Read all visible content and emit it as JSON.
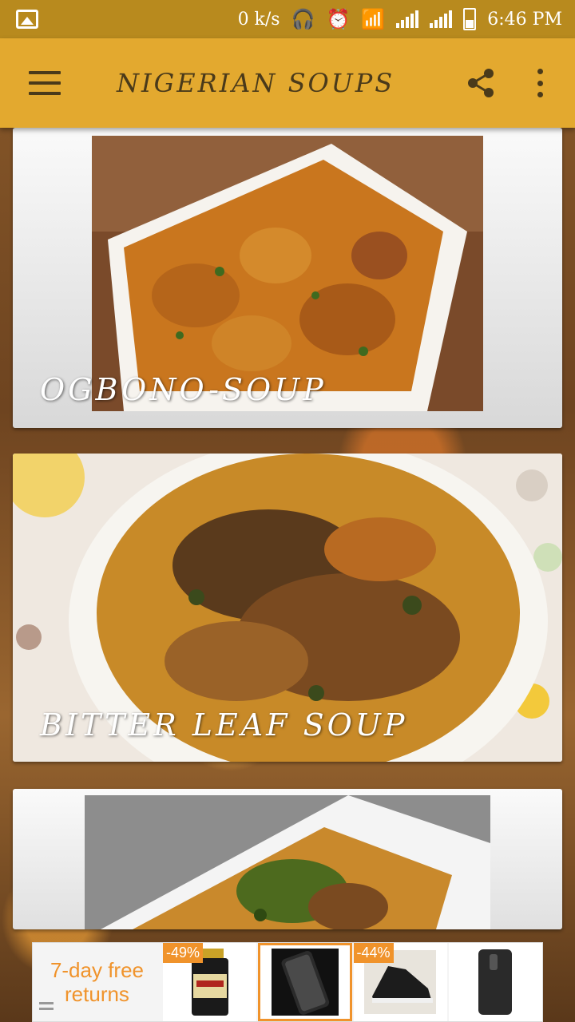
{
  "status_bar": {
    "net_speed": "0 k/s",
    "time": "6:46 PM"
  },
  "app_bar": {
    "title": "NIGERIAN SOUPS"
  },
  "soups": [
    {
      "label": "OGBONO-SOUP"
    },
    {
      "label": "BITTER LEAF SOUP"
    },
    {
      "label": ""
    }
  ],
  "ad": {
    "headline_line1": "7-day free",
    "headline_line2": "returns",
    "items": [
      {
        "badge": "-49%",
        "product": "supplement-bottle"
      },
      {
        "badge": "",
        "product": "phone-case"
      },
      {
        "badge": "-44%",
        "product": "sneaker"
      },
      {
        "badge": "",
        "product": "phone-back"
      }
    ]
  },
  "colors": {
    "status_bar": "#b88a1e",
    "app_bar": "#e3a92f",
    "ad_accent": "#f0932b"
  }
}
